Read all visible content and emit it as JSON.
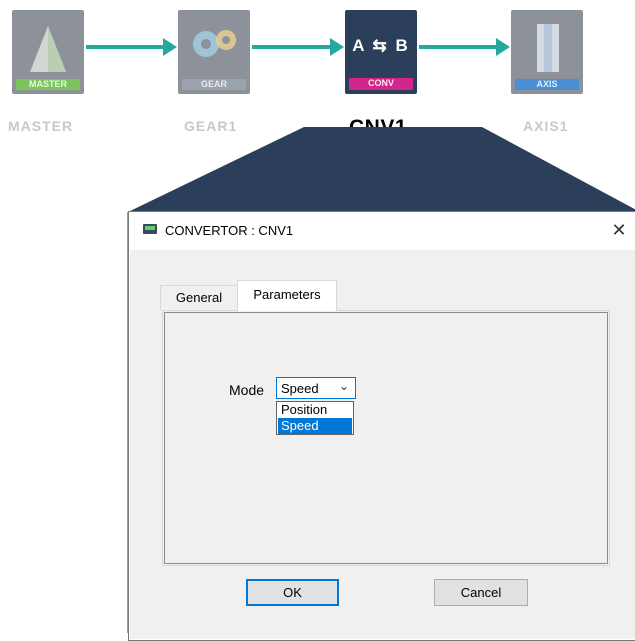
{
  "pipeline": {
    "nodes": [
      {
        "tile_text": "MASTER",
        "label": "MASTER"
      },
      {
        "tile_text": "GEAR",
        "label": "GEAR1"
      },
      {
        "tile_text": "CONV",
        "label": "CNV1",
        "glyph": "A ⇆ B"
      },
      {
        "tile_text": "AXIS",
        "label": "AXIS1"
      }
    ],
    "colors": {
      "connector": "#26a99a",
      "master_strip": "#79c45b",
      "conv_strip": "#d1268a",
      "axis_strip": "#4a8fd4"
    }
  },
  "dialog": {
    "title": "CONVERTOR : CNV1",
    "close_glyph": "✕",
    "tabs": [
      {
        "label": "General"
      },
      {
        "label": "Parameters"
      }
    ],
    "mode": {
      "label": "Mode",
      "selected": "Speed",
      "options": [
        "Position",
        "Speed"
      ]
    },
    "ok_label": "OK",
    "cancel_label": "Cancel",
    "icons": {
      "title": "convertor-window-icon",
      "select": "chevron-down-icon"
    }
  }
}
